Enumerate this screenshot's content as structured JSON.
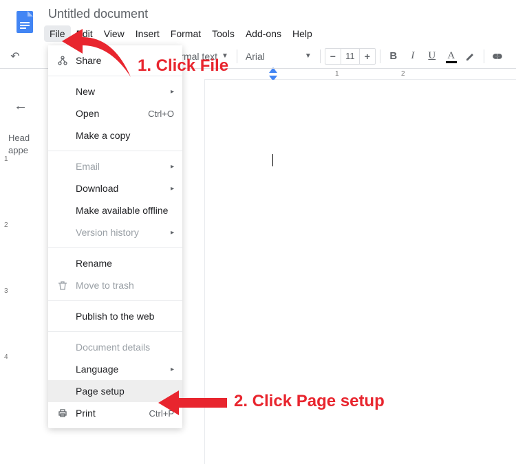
{
  "header": {
    "title": "Untitled document"
  },
  "menubar": {
    "items": [
      {
        "label": "File",
        "active": true
      },
      {
        "label": "Edit",
        "active": false
      },
      {
        "label": "View",
        "active": false
      },
      {
        "label": "Insert",
        "active": false
      },
      {
        "label": "Format",
        "active": false
      },
      {
        "label": "Tools",
        "active": false
      },
      {
        "label": "Add-ons",
        "active": false
      },
      {
        "label": "Help",
        "active": false
      }
    ]
  },
  "toolbar": {
    "style": "ormal text",
    "font": "Arial",
    "font_size": "11",
    "minus": "−",
    "plus": "+",
    "bold": "B",
    "italic": "I",
    "underline": "U",
    "text_color": "A"
  },
  "outline": {
    "placeholder_line1": "Head",
    "placeholder_line2": "appe"
  },
  "ruler": {
    "marks": [
      "1",
      "2"
    ]
  },
  "v_ruler": {
    "marks": [
      "1",
      "2",
      "3",
      "4"
    ]
  },
  "file_menu": {
    "items": [
      {
        "type": "item",
        "label": "Share",
        "icon": "share"
      },
      {
        "type": "sep"
      },
      {
        "type": "item",
        "label": "New",
        "submenu": true
      },
      {
        "type": "item",
        "label": "Open",
        "shortcut": "Ctrl+O"
      },
      {
        "type": "item",
        "label": "Make a copy"
      },
      {
        "type": "sep"
      },
      {
        "type": "item",
        "label": "Email",
        "submenu": true,
        "disabled": true
      },
      {
        "type": "item",
        "label": "Download",
        "submenu": true
      },
      {
        "type": "item",
        "label": "Make available offline"
      },
      {
        "type": "item",
        "label": "Version history",
        "submenu": true,
        "disabled": true
      },
      {
        "type": "sep"
      },
      {
        "type": "item",
        "label": "Rename"
      },
      {
        "type": "item",
        "label": "Move to trash",
        "icon": "trash",
        "disabled": true
      },
      {
        "type": "sep"
      },
      {
        "type": "item",
        "label": "Publish to the web"
      },
      {
        "type": "sep"
      },
      {
        "type": "item",
        "label": "Document details",
        "disabled": true
      },
      {
        "type": "item",
        "label": "Language",
        "submenu": true
      },
      {
        "type": "item",
        "label": "Page setup",
        "highlighted": true
      },
      {
        "type": "item",
        "label": "Print",
        "icon": "print",
        "shortcut": "Ctrl+P"
      }
    ]
  },
  "annotations": {
    "step1": "1. Click File",
    "step2": "2. Click Page setup"
  }
}
